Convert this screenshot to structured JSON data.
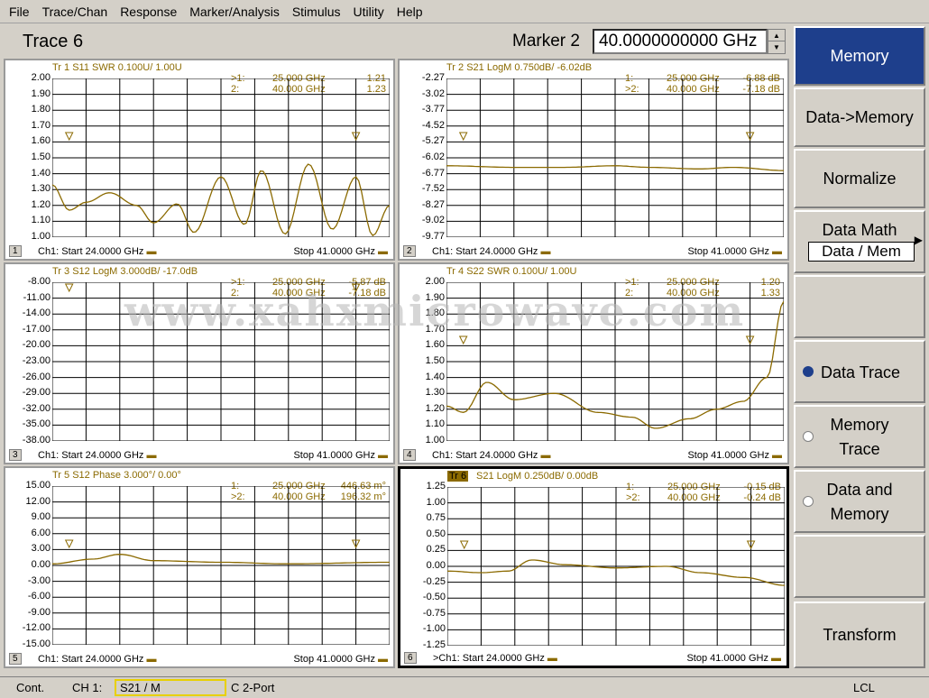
{
  "menu": [
    "File",
    "Trace/Chan",
    "Response",
    "Marker/Analysis",
    "Stimulus",
    "Utility",
    "Help"
  ],
  "title": "Trace 6",
  "marker_label": "Marker 2",
  "marker_value": "40.0000000000 GHz",
  "watermark": "www.xahxmicrowave.com",
  "panels": [
    {
      "num": "1",
      "header": "Tr 1  S11 SWR 0.100U/  1.00U",
      "yticks": [
        "2.00",
        "1.90",
        "1.80",
        "1.70",
        "1.60",
        "1.50",
        "1.40",
        "1.30",
        "1.20",
        "1.10",
        "1.00"
      ],
      "markers": [
        {
          "id": ">1:",
          "f": "25.000 GHz",
          "v": "1.21"
        },
        {
          "id": "2:",
          "f": "40.000 GHz",
          "v": "1.23"
        }
      ],
      "start": "Ch1: Start  24.0000 GHz",
      "stop": "Stop  41.0000 GHz"
    },
    {
      "num": "2",
      "header": "Tr 2  S21 LogM 0.750dB/  -6.02dB",
      "yticks": [
        "-2.27",
        "-3.02",
        "-3.77",
        "-4.52",
        "-5.27",
        "-6.02",
        "-6.77",
        "-7.52",
        "-8.27",
        "-9.02",
        "-9.77"
      ],
      "markers": [
        {
          "id": "1:",
          "f": "25.000 GHz",
          "v": "-6.88 dB"
        },
        {
          "id": ">2:",
          "f": "40.000 GHz",
          "v": "-7.18 dB"
        }
      ],
      "start": "Ch1: Start  24.0000 GHz",
      "stop": "Stop  41.0000 GHz"
    },
    {
      "num": "3",
      "header": "Tr 3  S12 LogM 3.000dB/  -17.0dB",
      "yticks": [
        "-8.00",
        "-11.00",
        "-14.00",
        "-17.00",
        "-20.00",
        "-23.00",
        "-26.00",
        "-29.00",
        "-32.00",
        "-35.00",
        "-38.00"
      ],
      "markers": [
        {
          "id": ">1:",
          "f": "25.000 GHz",
          "v": "-5.87 dB"
        },
        {
          "id": "2:",
          "f": "40.000 GHz",
          "v": "-7.18 dB"
        }
      ],
      "start": "Ch1: Start  24.0000 GHz",
      "stop": "Stop  41.0000 GHz"
    },
    {
      "num": "4",
      "header": "Tr 4  S22 SWR 0.100U/  1.00U",
      "yticks": [
        "2.00",
        "1.90",
        "1.80",
        "1.70",
        "1.60",
        "1.50",
        "1.40",
        "1.30",
        "1.20",
        "1.10",
        "1.00"
      ],
      "markers": [
        {
          "id": ">1:",
          "f": "25.000 GHz",
          "v": "1.20"
        },
        {
          "id": "2:",
          "f": "40.000 GHz",
          "v": "1.33"
        }
      ],
      "start": "Ch1: Start  24.0000 GHz",
      "stop": "Stop  41.0000 GHz"
    },
    {
      "num": "5",
      "header": "Tr 5  S12 Phase 3.000°/  0.00°",
      "yticks": [
        "15.00",
        "12.00",
        "9.00",
        "6.00",
        "3.00",
        "0.00",
        "-3.00",
        "-6.00",
        "-9.00",
        "-12.00",
        "-15.00"
      ],
      "markers": [
        {
          "id": "1:",
          "f": "25.000 GHz",
          "v": "446.63 m°"
        },
        {
          "id": ">2:",
          "f": "40.000 GHz",
          "v": "196.32 m°"
        }
      ],
      "start": "Ch1: Start  24.0000 GHz",
      "stop": "Stop  41.0000 GHz"
    },
    {
      "num": "6",
      "header_tag": "Tr 6",
      "header": "S21 LogM 0.250dB/  0.00dB",
      "yticks": [
        "1.25",
        "1.00",
        "0.75",
        "0.50",
        "0.25",
        "0.00",
        "-0.25",
        "-0.50",
        "-0.75",
        "-1.00",
        "-1.25"
      ],
      "markers": [
        {
          "id": "1:",
          "f": "25.000 GHz",
          "v": "-0.15 dB"
        },
        {
          "id": ">2:",
          "f": "40.000 GHz",
          "v": "-0.24 dB"
        }
      ],
      "start": ">Ch1: Start  24.0000 GHz",
      "stop": "Stop  41.0000 GHz"
    }
  ],
  "softkeys": {
    "memory": "Memory",
    "data_to_memory": "Data->Memory",
    "normalize": "Normalize",
    "data_math": "Data Math",
    "data_math_value": "Data / Mem",
    "data_trace": "Data Trace",
    "memory_trace_1": "Memory",
    "memory_trace_2": "Trace",
    "data_and_memory_1": "Data and",
    "data_and_memory_2": "Memory",
    "transform": "Transform"
  },
  "status": {
    "mode": "Cont.",
    "ch": "CH 1:",
    "meas": "S21 / M",
    "cal": "C  2-Port",
    "lcl": "LCL"
  },
  "colors": {
    "trace": "#8b6a00",
    "active_key": "#1e3f8c"
  }
}
